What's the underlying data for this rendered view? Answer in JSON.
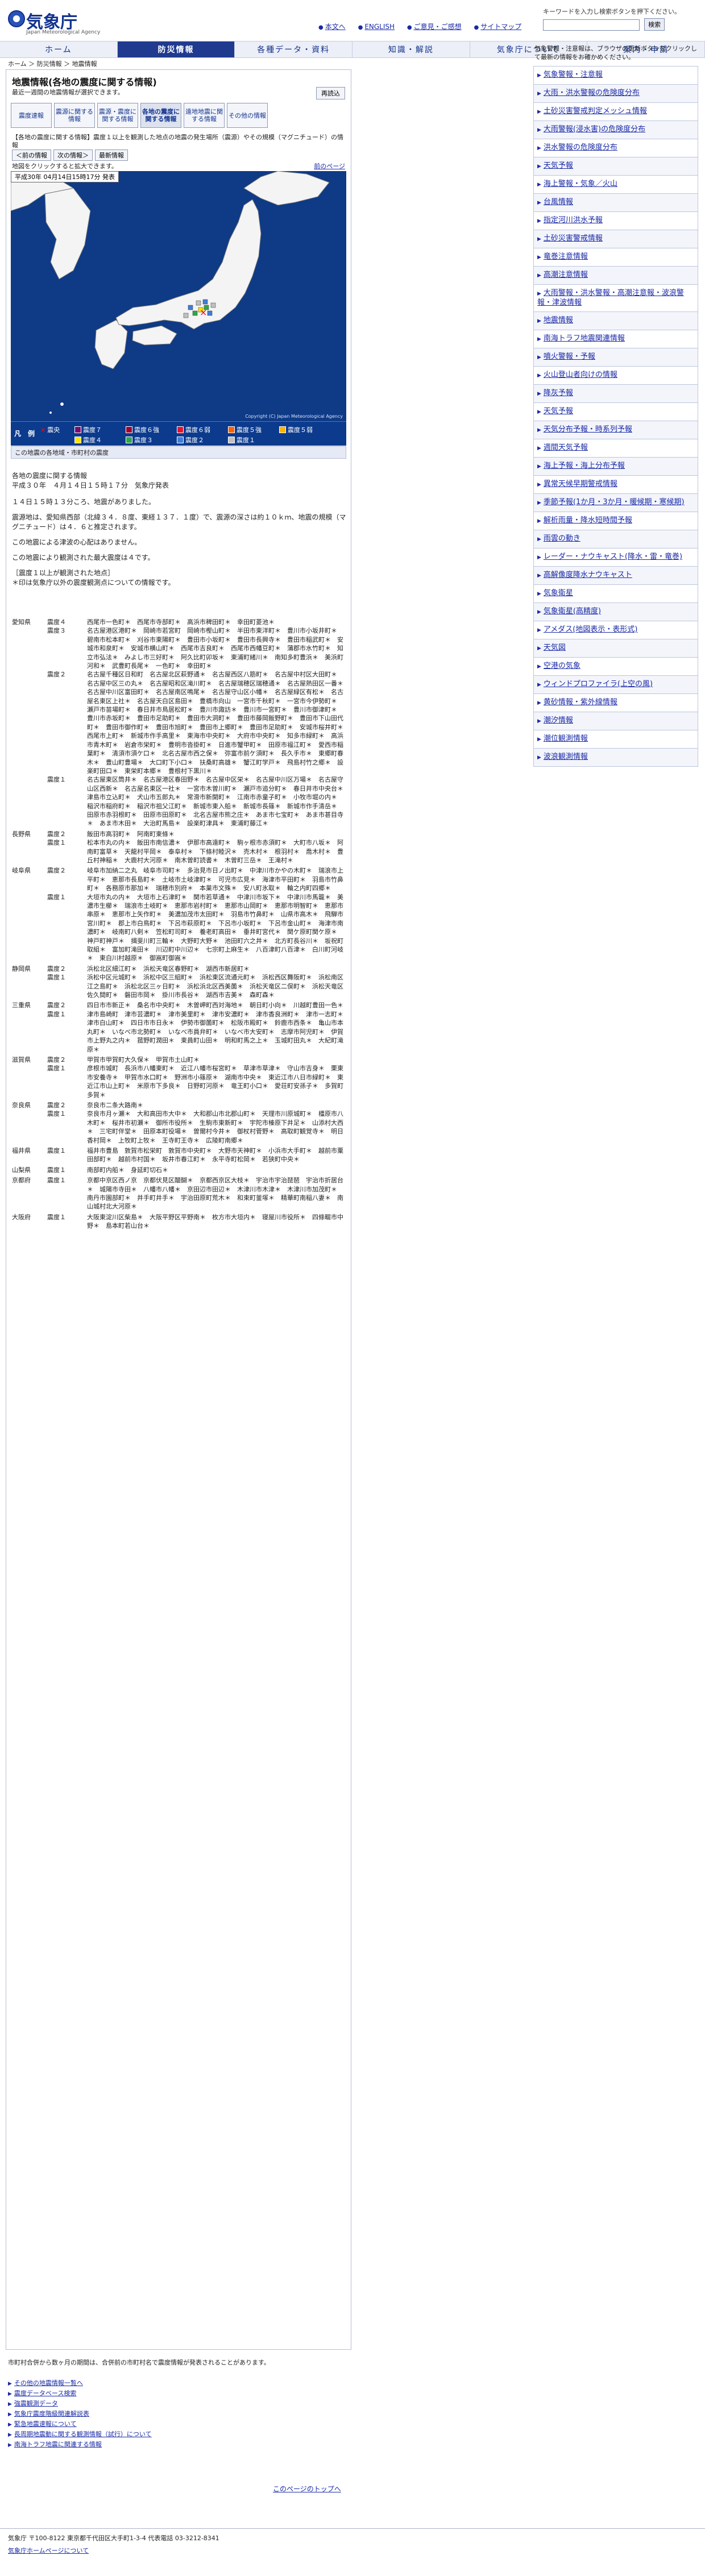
{
  "header": {
    "logo_text": "気象庁",
    "logo_sub": "Japan Meteorological Agency",
    "top_links": [
      "本文へ",
      "ENGLISH",
      "ご意見・ご感想",
      "サイトマップ"
    ],
    "keyword_note": "キーワードを入力し検索ボタンを押下ください。",
    "search_placeholder": "",
    "search_button": "検索"
  },
  "nav": [
    "ホーム",
    "防災情報",
    "各種データ・資料",
    "知識・解説",
    "気象庁について",
    "案内・申請"
  ],
  "breadcrumb": "ホーム ＞ 防災情報 ＞ 地震情報",
  "main": {
    "title": "地震情報(各地の震度に関する情報)",
    "subtitle": "最近一週間の地震情報が選択できます。",
    "print_label": "再読込",
    "tabs": [
      "震度速報",
      "震源に関する情報",
      "震源・震度に関する情報",
      "各地の震度に関する情報",
      "遠地地震に関する情報",
      "その他の情報"
    ],
    "info_note": "【各地の震度に関する情報】震度１以上を観測した地点の地震の発生場所（震源）やその規模（マグニチュード）の情報",
    "view_buttons": [
      "＜前の情報",
      "次の情報＞",
      "最新情報"
    ],
    "map_note": "地図をクリックすると拡大できます。",
    "prev_link": "前のページ",
    "map_time": "平成30年 04月14日15時17分 発表",
    "map_copyright": "Copyright (C) Japan Meteorological Agency",
    "legend_title": "凡　例",
    "legend": [
      {
        "label": "震央",
        "color": "#ff0000"
      },
      {
        "label": "震度７",
        "color": "#7a0a6e"
      },
      {
        "label": "震度６強",
        "color": "#a1002d"
      },
      {
        "label": "震度６弱",
        "color": "#e5132f"
      },
      {
        "label": "震度５強",
        "color": "#ff6200"
      },
      {
        "label": "震度５弱",
        "color": "#ffb400"
      },
      {
        "label": "震度４",
        "color": "#ffe100"
      },
      {
        "label": "震度３",
        "color": "#2fa64b"
      },
      {
        "label": "震度２",
        "color": "#3e7ed9"
      },
      {
        "label": "震度１",
        "color": "#c0c0c0"
      }
    ],
    "caption": "この地震の各地域・市町村の震度",
    "report_title": "各地の震度に関する情報",
    "report_issued": "平成３０年　４月１４日１５時１７分　気象庁発表",
    "report_paragraphs": [
      "１４日１５時１３分ころ、地震がありました。",
      "震源地は、愛知県西部（北緯３４．８度、東経１３７．１度）で、震源の深さは約１０ｋｍ、地震の規模（マグニチュード）は４．６と推定されます。",
      "この地震による津波の心配はありません。",
      "この地震により観測された最大震度は４です。"
    ],
    "listing_header": "［震度１以上が観測された地点］",
    "listing_note": "＊印は気象庁以外の震度観測点についての情報です。",
    "listing": [
      {
        "pref": "愛知県",
        "rows": [
          {
            "int": "震度４",
            "places": "西尾市一色町＊　西尾市寺部町＊　高浜市稗田町＊　幸田町菱池＊"
          },
          {
            "int": "震度３",
            "places": "名古屋港区港町＊　岡崎市若宮町　岡崎市樫山町＊　半田市東洋町＊　豊川市小坂井町＊　碧南市松本町＊　刈谷市東陽町＊　豊田市小坂町＊　豊田市長興寺＊　豊田市稲武町＊　安城市和泉町＊　安城市横山町＊　西尾市吉良町＊　西尾市西幡豆町＊　蒲郡市水竹町＊　知立市弘法＊　みよし市三好町＊　阿久比町卯坂＊　東浦町緒川＊　南知多町豊浜＊　美浜町河和＊　武豊町長尾＊　一色町＊　幸田町＊"
          },
          {
            "int": "震度２",
            "places": "名古屋千種区日和町　名古屋北区萩野通＊　名古屋西区八筋町＊　名古屋中村区大田町＊　名古屋中区三の丸＊　名古屋昭和区滝川町＊　名古屋瑞穂区瑞穂通＊　名古屋熱田区一番＊　名古屋中川区富田町＊　名古屋南区鳴尾＊　名古屋守山区小幡＊　名古屋緑区有松＊　名古屋名東区上社＊　名古屋天白区島田＊　豊橋市向山　一宮市千秋町＊　一宮市今伊勢町＊　瀬戸市苗場町＊　春日井市鳥居松町＊　豊川市諏訪＊　豊川市一宮町＊　豊川市御津町＊　豊川市赤坂町＊　豊田市足助町＊　豊田市大洞町＊　豊田市藤岡飯野町＊　豊田市下山田代町＊　豊田市御作町＊　豊田市旭町＊　豊田市上郷町＊　豊田市足助町＊　安城市桜井町＊　西尾市上町＊　新城市作手高里＊　東海市中央町＊　大府市中央町＊　知多市緑町＊　高浜市青木町＊　岩倉市栄町＊　豊明市沓掛町＊　日進市蟹甲町＊　田原市福江町＊　愛西市稲葉町＊　清須市須ケ口＊　北名古屋市西之保＊　弥富市前ケ須町＊　長久手市＊　東郷町春木＊　豊山町豊場＊　大口町下小口＊　扶桑町高雄＊　蟹江町学戸＊　飛島村竹之郷＊　設楽町田口＊　東栄町本郷＊　豊根村下黒川＊"
          },
          {
            "int": "震度１",
            "places": "名古屋東区筒井＊　名古屋港区春田野＊　名古屋中区栄＊　名古屋中川区万場＊　名古屋守山区西新＊　名古屋名東区一社＊　一宮市木曽川町＊　瀬戸市追分町＊　春日井市中央台＊　津島市立込町＊　犬山市五郎丸＊　常滑市新開町＊　江南市赤童子町＊　小牧市堀の内＊　稲沢市稲府町＊　稲沢市祖父江町＊　新城市東入船＊　新城市長篠＊　新城市作手清岳＊　田原市赤羽根町＊　田原市田原町＊　北名古屋市熊之庄＊　あま市七宝町＊　あま市甚目寺＊　あま市木田＊　大治町馬島＊　設楽町津具＊　東浦町藤江＊"
          }
        ]
      },
      {
        "pref": "長野県",
        "rows": [
          {
            "int": "震度２",
            "places": "飯田市高羽町＊　阿南町東條＊"
          },
          {
            "int": "震度１",
            "places": "松本市丸の内＊　飯田市南信濃＊　伊那市高遠町＊　駒ヶ根市赤須町＊　大町市八坂＊　阿南町富草＊　天龍村平岡＊　泰阜村＊　下條村睦沢＊　売木村＊　根羽村＊　喬木村＊　豊丘村神稲＊　大鹿村大河原＊　南木曽町読書＊　木曽町三岳＊　王滝村＊"
          }
        ]
      },
      {
        "pref": "岐阜県",
        "rows": [
          {
            "int": "震度２",
            "places": "岐阜市加納二之丸　岐阜市司町＊　多治見市日ノ出町＊　中津川市かやの木町＊　瑞浪市上平町＊　恵那市長島町＊　土岐市土岐津町＊　可児市広見＊　海津市平田町＊　羽島市竹鼻町＊　各務原市那加＊　瑞穂市別府＊　本巣市文殊＊　安八町氷取＊　輪之内町四郷＊"
          },
          {
            "int": "震度１",
            "places": "大垣市丸の内＊　大垣市上石津町＊　関市若草通＊　中津川市坂下＊　中津川市馬籠＊　美濃市生櫛＊　瑞浪市土岐町＊　恵那市岩村町＊　恵那市山岡町＊　恵那市明智町＊　恵那市串原＊　恵那市上矢作町＊　美濃加茂市太田町＊　羽島市竹鼻町＊　山県市高木＊　飛騨市宮川町＊　郡上市白鳥町＊　下呂市萩原町＊　下呂市小坂町＊　下呂市金山町＊　海津市南濃町＊　岐南町八剣＊　笠松町司町＊　養老町高田＊　垂井町宮代＊　関ケ原町関ケ原＊　神戸町神戸＊　揖斐川町三輪＊　大野町大野＊　池田町六之井＊　北方町長谷川＊　坂祝町取組＊　富加町滝田＊　川辺町中川辺＊　七宗町上麻生＊　八百津町八百津＊　白川町河岐＊　東白川村越原＊　御嵩町御嵩＊"
          }
        ]
      },
      {
        "pref": "静岡県",
        "rows": [
          {
            "int": "震度２",
            "places": "浜松北区細江町＊　浜松天竜区春野町＊　湖西市新居町＊"
          },
          {
            "int": "震度１",
            "places": "浜松中区元城町＊　浜松中区三組町＊　浜松東区流通元町＊　浜松西区舞阪町＊　浜松南区江之島町＊　浜松北区三ヶ日町＊　浜松浜北区西美薗＊　浜松天竜区二俣町＊　浜松天竜区佐久間町＊　磐田市岡＊　掛川市長谷＊　湖西市吉美＊　森町森＊"
          }
        ]
      },
      {
        "pref": "三重県",
        "rows": [
          {
            "int": "震度２",
            "places": "四日市市新正＊　桑名市中央町＊　木曽岬町西対海地＊　朝日町小向＊　川越町豊田一色＊"
          },
          {
            "int": "震度１",
            "places": "津市島崎町　津市芸濃町＊　津市美里町＊　津市安濃町＊　津市香良洲町＊　津市一志町＊　津市白山町＊　四日市市日永＊　伊勢市御薗町＊　松阪市殿町＊　鈴鹿市西条＊　亀山市本丸町＊　いなべ市北勢町＊　いなべ市員弁町＊　いなべ市大安町＊　志摩市阿児町＊　伊賀市上野丸之内＊　菰野町潤田＊　東員町山田＊　明和町馬之上＊　玉城町田丸＊　大紀町滝原＊"
          }
        ]
      },
      {
        "pref": "滋賀県",
        "rows": [
          {
            "int": "震度２",
            "places": "甲賀市甲賀町大久保＊　甲賀市土山町＊"
          },
          {
            "int": "震度１",
            "places": "彦根市城町　長浜市八幡東町＊　近江八幡市桜宮町＊　草津市草津＊　守山市吉身＊　栗東市安養寺＊　甲賀市水口町＊　野洲市小篠原＊　湖南市中央＊　東近江市八日市緑町＊　東近江市山上町＊　米原市下多良＊　日野町河原＊　竜王町小口＊　愛荘町安孫子＊　多賀町多賀＊"
          }
        ]
      },
      {
        "pref": "奈良県",
        "rows": [
          {
            "int": "震度２",
            "places": "奈良市二条大路南＊"
          },
          {
            "int": "震度１",
            "places": "奈良市月ヶ瀬＊　大和高田市大中＊　大和郡山市北郡山町＊　天理市川原城町＊　橿原市八木町＊　桜井市初瀬＊　御所市役所＊　生駒市東新町＊　宇陀市榛原下井足＊　山添村大西＊　三宅町伴堂＊　田原本町役場＊　曽爾村今井＊　御杖村菅野＊　高取町観覚寺＊　明日香村岡＊　上牧町上牧＊　王寺町王寺＊　広陵町南郷＊"
          }
        ]
      },
      {
        "pref": "福井県",
        "rows": [
          {
            "int": "震度１",
            "places": "福井市豊島　敦賀市松栄町　敦賀市中央町＊　大野市天神町＊　小浜市大手町＊　越前市粟田部町＊　越前市村国＊　坂井市春江町＊　永平寺町松岡＊　若狭町中央＊"
          }
        ]
      },
      {
        "pref": "山梨県",
        "rows": [
          {
            "int": "震度１",
            "places": "南部町内船＊　身延町切石＊"
          }
        ]
      },
      {
        "pref": "京都府",
        "rows": [
          {
            "int": "震度１",
            "places": "京都中京区西ノ京　京都伏見区醍醐＊　京都西京区大枝＊　宇治市宇治琵琶　宇治市折居台＊　城陽市寺田＊　八幡市八幡＊　京田辺市田辺＊　木津川市木津＊　木津川市加茂町＊　南丹市園部町＊　井手町井手＊　宇治田原町荒木＊　和束町釜塚＊　精華町南稲八妻＊　南山城村北大河原＊"
          }
        ]
      },
      {
        "pref": "大阪府",
        "rows": [
          {
            "int": "震度１",
            "places": "大阪東淀川区柴島＊　大阪平野区平野南＊　枚方市大垣内＊　寝屋川市役所＊　四條畷市中野＊　島本町若山台＊"
          }
        ]
      }
    ]
  },
  "sidebar": {
    "note": "気象警報・注意報は、ブラウザの更新ボタンをクリックして最新の情報をお確かめください。",
    "items": [
      "気象警報・注意報",
      "大雨・洪水警報の危険度分布",
      "土砂災害警戒判定メッシュ情報",
      "大雨警報(浸水害)の危険度分布",
      "洪水警報の危険度分布",
      "天気予報",
      "海上警報・気象／火山",
      "台風情報",
      "指定河川洪水予報",
      "土砂災害警戒情報",
      "竜巻注意情報",
      "高潮注意情報",
      "大雨警報・洪水警報・高潮注意報・波浪警報・津波情報",
      "地震情報",
      "南海トラフ地震関連情報",
      "噴火警報・予報",
      "火山登山者向けの情報",
      "降灰予報",
      "天気予報",
      "天気分布予報・時系列予報",
      "週間天気予報",
      "海上予報・海上分布予報",
      "異常天候早期警戒情報",
      "季節予報(1か月・3か月・暖候期・寒候期)",
      "解析雨量・降水短時間予報",
      "雨雲の動き",
      "レーダー・ナウキャスト(降水・雷・竜巻)",
      "高解像度降水ナウキャスト",
      "気象衛星",
      "気象衛星(高精度)",
      "アメダス(地図表示・表形式)",
      "天気図",
      "空港の気象",
      "ウィンドプロファイラ(上空の風)",
      "黄砂情報・紫外線情報",
      "潮汐情報",
      "潮位観測情報",
      "波浪観測情報"
    ]
  },
  "footer": {
    "footnote": "市町村合併から数ヶ月の期間は、合併前の市町村名で震度情報が発表されることがあります。",
    "related_links": [
      "その他の地震情報一覧へ",
      "震度データベース検索",
      "強震観測データ",
      "気象庁震度階級関連解説表",
      "緊急地震速報について",
      "長周期地震動に関する観測情報（試行）について",
      "南海トラフ地震に関連する情報"
    ],
    "page_top": "このページのトップへ",
    "address": "気象庁 〒100-8122 東京都千代田区大手町1-3-4 代表電話 03-3212-8341",
    "footer_link": "気象庁ホームページについて"
  }
}
